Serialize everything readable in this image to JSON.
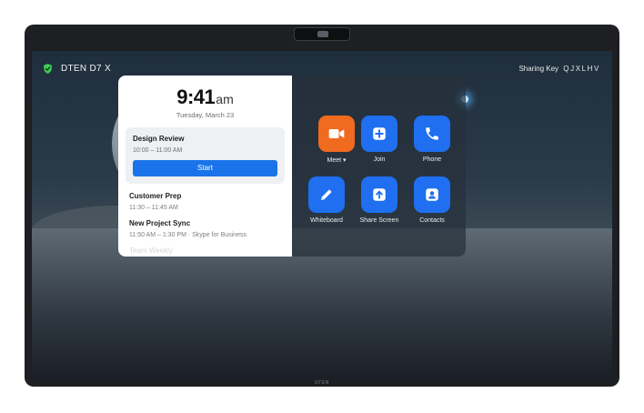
{
  "device": {
    "chin_logo": "DTEN"
  },
  "top_bar": {
    "device_name": "DTEN D7 X",
    "sharing_label": "Sharing Key",
    "sharing_key": "QJXLHV"
  },
  "clock": {
    "time": "9:41",
    "ampm": "am",
    "date": "Tuesday, March 23"
  },
  "current_meeting": {
    "title": "Design Review",
    "time": "10:00 – 11:00 AM",
    "button_label": "Start"
  },
  "meetings": [
    {
      "title": "Customer Prep",
      "time": "11:30 – 11:45 AM"
    },
    {
      "title": "New Project Sync",
      "time": "11:50 AM – 1:30 PM · Skype for Business"
    },
    {
      "title": "Team Weekly"
    }
  ],
  "apps": [
    {
      "label": "Meet",
      "icon": "video-camera-icon",
      "color": "#f06a1f"
    },
    {
      "label": "Join",
      "icon": "plus-icon",
      "color": "#1f6ff0"
    },
    {
      "label": "Phone",
      "icon": "phone-icon",
      "color": "#1f6ff0"
    },
    {
      "label": "Whiteboard",
      "icon": "pencil-icon",
      "color": "#1f6ff0"
    },
    {
      "label": "Share Screen",
      "icon": "upload-icon",
      "color": "#1f6ff0"
    },
    {
      "label": "Contacts",
      "icon": "contact-icon",
      "color": "#1f6ff0"
    }
  ],
  "colors": {
    "accent": "#1a73e8",
    "shield": "#3fcf5a"
  }
}
